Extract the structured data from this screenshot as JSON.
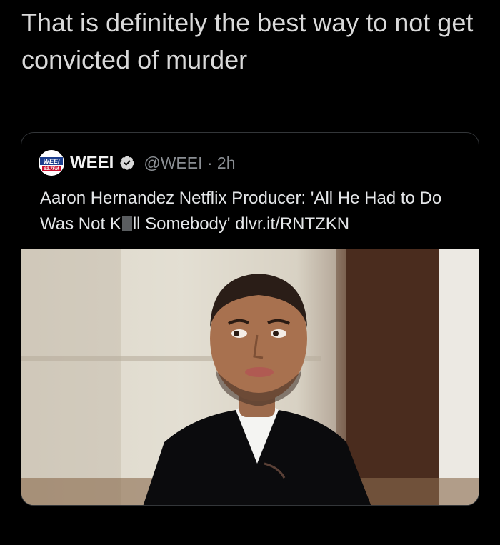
{
  "tweet": {
    "text": "That is definitely the best way to not get convicted of murder"
  },
  "quoted": {
    "avatar_text": "WEEI",
    "avatar_sub": "93.7FM",
    "display_name": "WEEI",
    "handle_time": "@WEEI · 2h",
    "text_before": "Aaron Hernandez Netflix Producer: 'All He Had to Do Was Not K",
    "text_after": "ll Somebody' dlvr.it/RNTZKN"
  },
  "colors": {
    "background": "#000000",
    "border": "#333639",
    "muted": "#8b8f94"
  },
  "icons": {
    "verified": "verified-badge-icon"
  }
}
